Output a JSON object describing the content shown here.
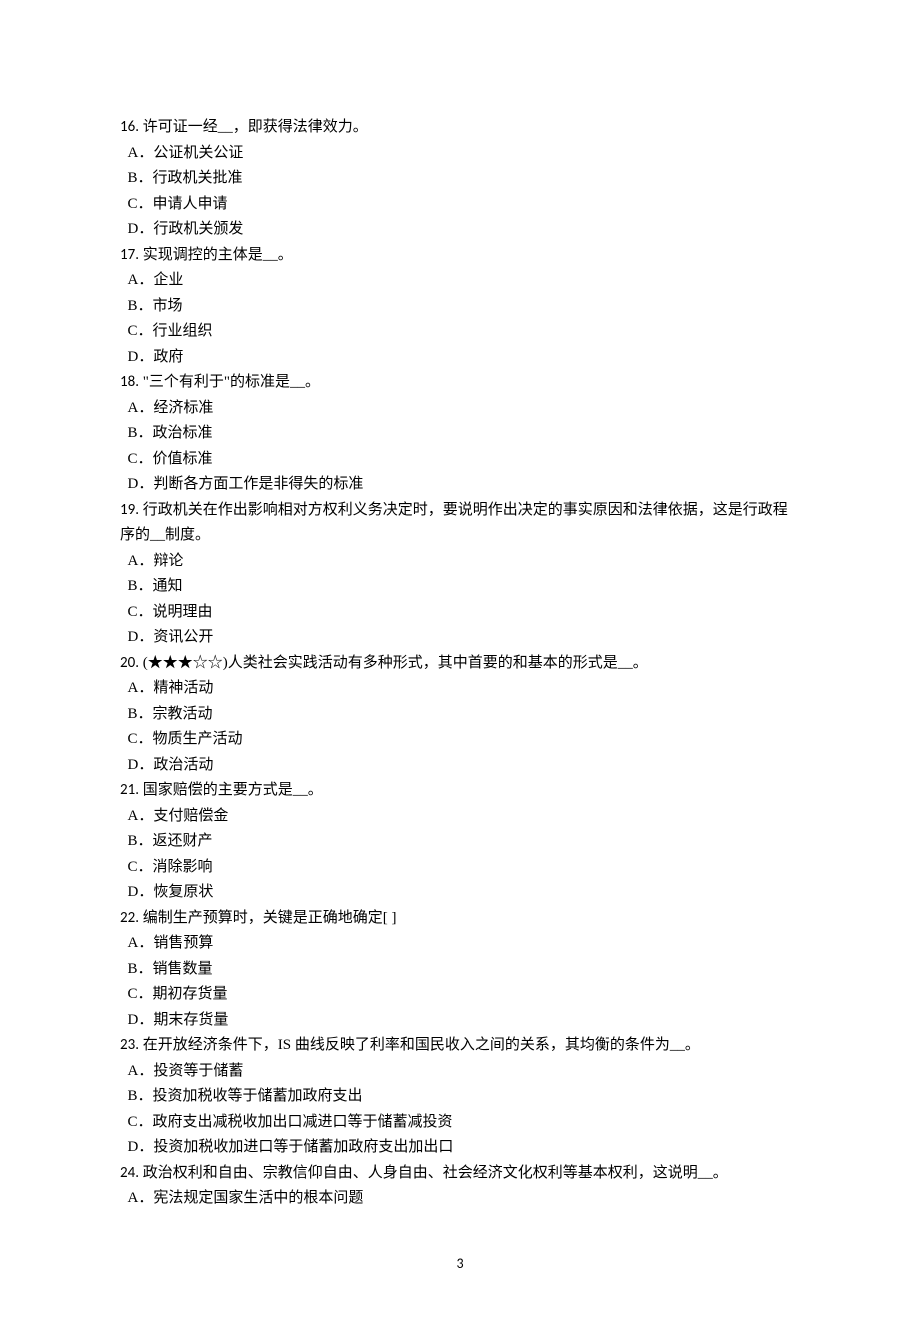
{
  "questions": [
    {
      "num": "16.",
      "text": "许可证一经__，即获得法律效力。",
      "options": [
        "A．公证机关公证",
        "B．行政机关批准",
        "C．申请人申请",
        "D．行政机关颁发"
      ]
    },
    {
      "num": "17.",
      "text": "实现调控的主体是__。",
      "options": [
        "A．企业",
        "B．市场",
        "C．行业组织",
        "D．政府"
      ]
    },
    {
      "num": "18.",
      "text": "\"三个有利于\"的标准是__。",
      "options": [
        "A．经济标准",
        "B．政治标准",
        "C．价值标准",
        "D．判断各方面工作是非得失的标准"
      ]
    },
    {
      "num": "19.",
      "text": "行政机关在作出影响相对方权利义务决定时，要说明作出决定的事实原因和法律依据，这是行政程序的__制度。",
      "options": [
        "A．辩论",
        "B．通知",
        "C．说明理由",
        "D．资讯公开"
      ]
    },
    {
      "num": "20.",
      "text": "(★★★☆☆)人类社会实践活动有多种形式，其中首要的和基本的形式是__。",
      "options": [
        "A．精神活动",
        "B．宗教活动",
        "C．物质生产活动",
        "D．政治活动"
      ]
    },
    {
      "num": "21.",
      "text": "国家赔偿的主要方式是__。",
      "options": [
        "A．支付赔偿金",
        "B．返还财产",
        "C．消除影响",
        "D．恢复原状"
      ]
    },
    {
      "num": "22.",
      "text": "编制生产预算时，关键是正确地确定[ ]",
      "options": [
        "A．销售预算",
        "B．销售数量",
        "C．期初存货量",
        "D．期末存货量"
      ]
    },
    {
      "num": "23.",
      "text": "在开放经济条件下，IS 曲线反映了利率和国民收入之间的关系，其均衡的条件为__。",
      "options": [
        "A．投资等于储蓄",
        "B．投资加税收等于储蓄加政府支出",
        "C．政府支出减税收加出口减进口等于储蓄减投资",
        "D．投资加税收加进口等于储蓄加政府支出加出口"
      ]
    },
    {
      "num": "24.",
      "text": "政治权利和自由、宗教信仰自由、人身自由、社会经济文化权利等基本权利，这说明__。",
      "options": [
        "A．宪法规定国家生活中的根本问题"
      ]
    }
  ],
  "pageNumber": "3"
}
